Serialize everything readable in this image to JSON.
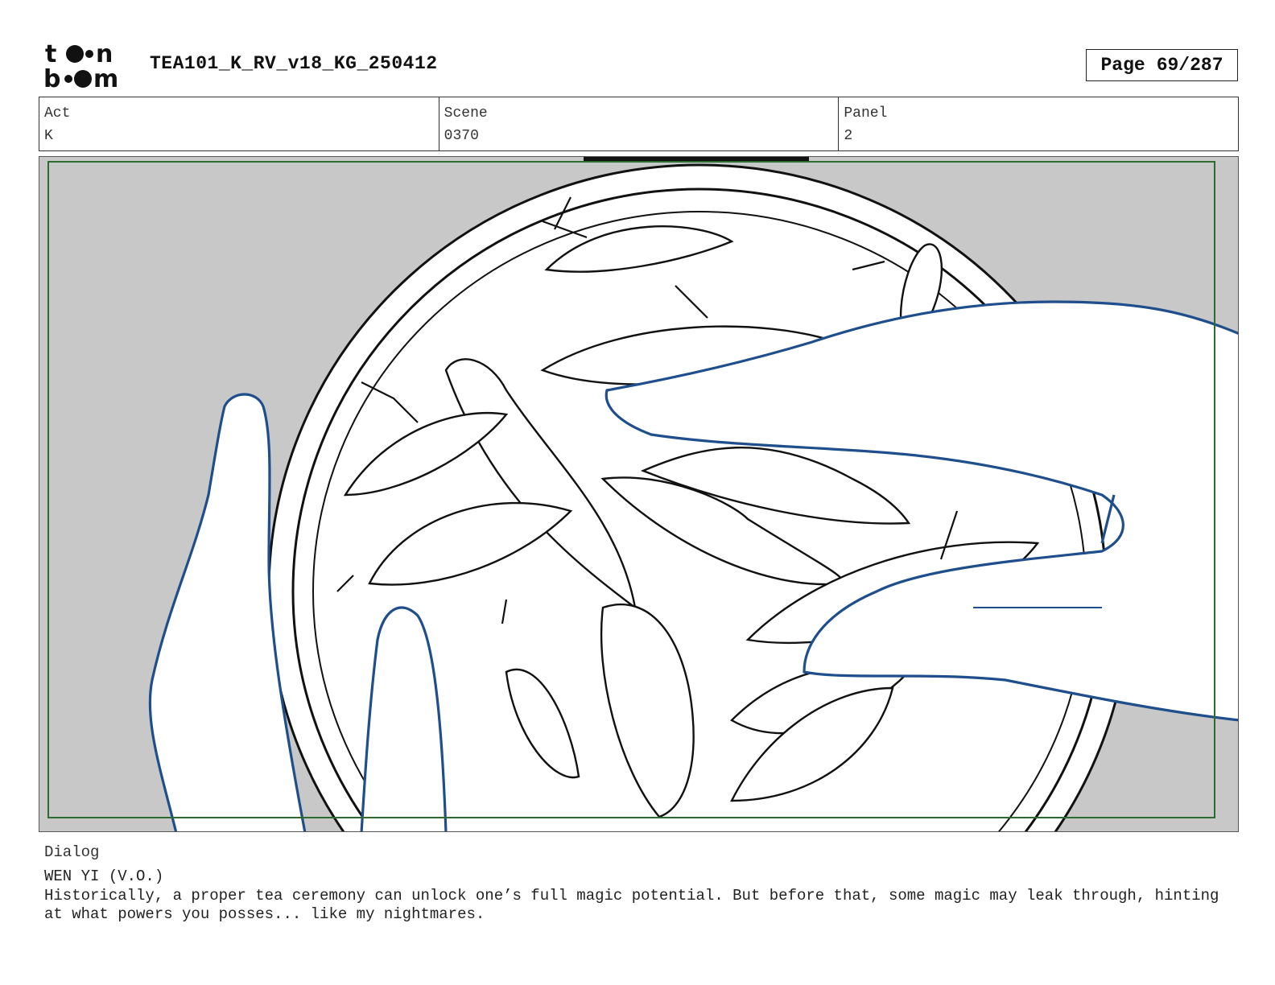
{
  "header": {
    "project_title": "TEA101_K_RV_v18_KG_250412",
    "page_label": "Page",
    "page_number": "69/287"
  },
  "info": {
    "act_label": "Act",
    "act_value": "K",
    "scene_label": "Scene",
    "scene_value": "0370",
    "panel_label": "Panel",
    "panel_value": "2"
  },
  "panel": {
    "background_color": "#c8c8c8",
    "safe_frame_color": "#2e6b2e",
    "hand_line_color": "#1f4e8c",
    "line_color": "#111111"
  },
  "dialog": {
    "label": "Dialog",
    "speaker": "WEN YI (V.O.)",
    "text": "Historically, a proper tea ceremony can unlock one’s full magic potential. But before that, some magic may leak through, hinting at what powers you posses... like my nightmares."
  }
}
